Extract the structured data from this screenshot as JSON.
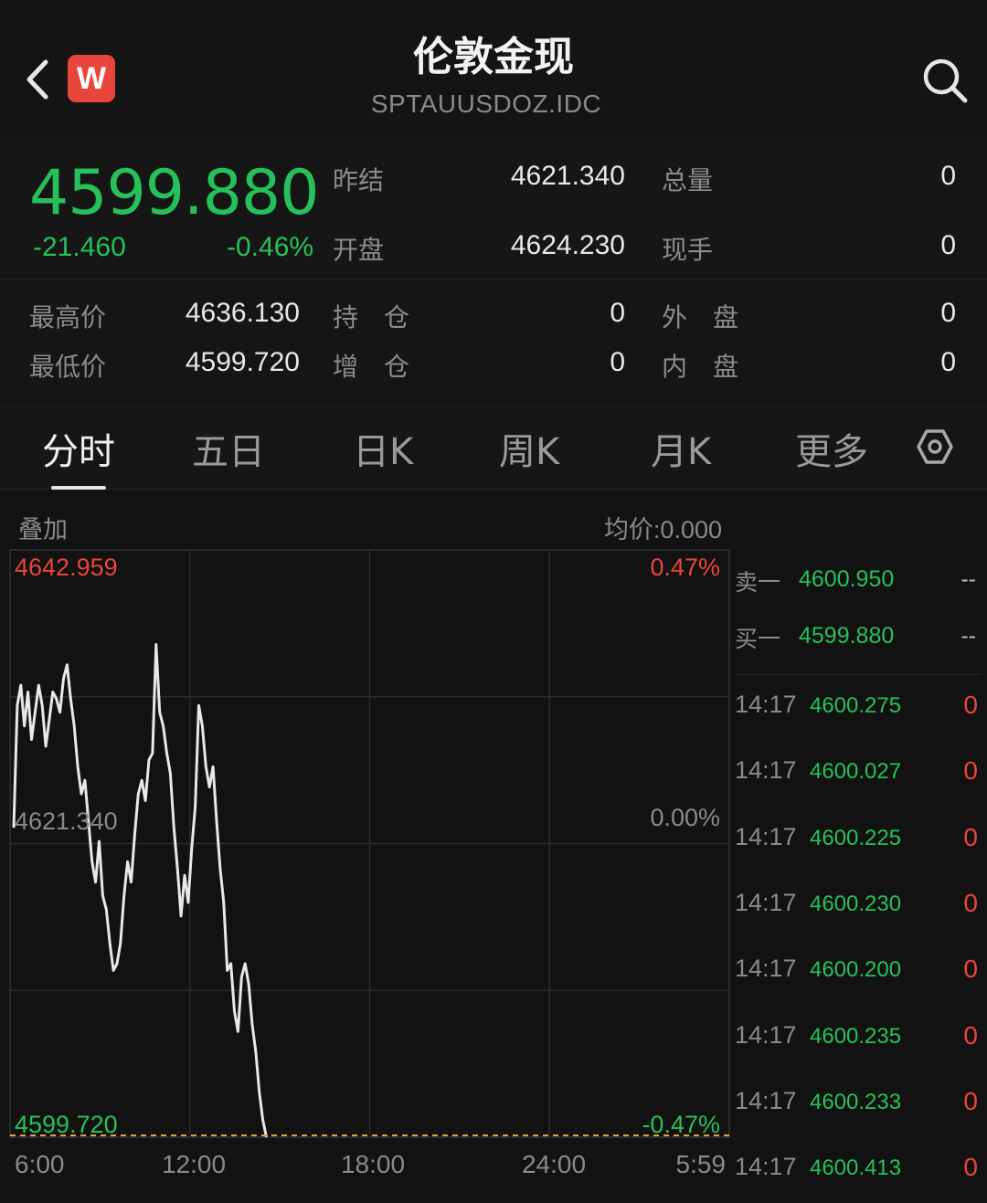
{
  "header": {
    "title": "伦敦金现",
    "code": "SPTAUUSDOZ.IDC",
    "brand_letter": "W"
  },
  "quote": {
    "price": "4599.880",
    "change": "-21.460",
    "change_pct": "-0.46%",
    "prev_settle_label": "昨结",
    "prev_settle": "4621.340",
    "open_label": "开盘",
    "open": "4624.230",
    "total_vol_label": "总量",
    "total_vol": "0",
    "current_hand_label": "现手",
    "current_hand": "0"
  },
  "stats": {
    "high_label": "最高价",
    "high": "4636.130",
    "low_label": "最低价",
    "low": "4599.720",
    "position_label": "持　仓",
    "position": "0",
    "add_position_label": "增　仓",
    "add_position": "0",
    "outer_label": "外　盘",
    "outer": "0",
    "inner_label": "内　盘",
    "inner": "0"
  },
  "tabs": [
    "分时",
    "五日",
    "日K",
    "周K",
    "月K",
    "更多"
  ],
  "chart_header": {
    "overlay_label": "叠加",
    "avg_price": "均价:0.000"
  },
  "chart_data": {
    "type": "line",
    "y_top_label": "4642.959",
    "y_mid_label": "4621.340",
    "y_bottom_label": "4599.720",
    "pct_top": "0.47%",
    "pct_mid": "0.00%",
    "pct_bottom": "-0.47%",
    "x_tick_labels": [
      "6:00",
      "12:00",
      "18:00",
      "24:00",
      "5:59"
    ],
    "ylim": [
      4599.72,
      4642.959
    ],
    "x_fraction_range": [
      0,
      1
    ],
    "series": [
      {
        "x": [
          0.0,
          0.005,
          0.01,
          0.015,
          0.02,
          0.025,
          0.03,
          0.035,
          0.04,
          0.045,
          0.05,
          0.055,
          0.06,
          0.065,
          0.07,
          0.075,
          0.08,
          0.085,
          0.09,
          0.095,
          0.1,
          0.105,
          0.11,
          0.115,
          0.12,
          0.125,
          0.13,
          0.135,
          0.14,
          0.145,
          0.15,
          0.155,
          0.16,
          0.165,
          0.17,
          0.175,
          0.18,
          0.185,
          0.19,
          0.195,
          0.2,
          0.205,
          0.21,
          0.215,
          0.22,
          0.225,
          0.23,
          0.235,
          0.24,
          0.245,
          0.25,
          0.255,
          0.26,
          0.265,
          0.27,
          0.275,
          0.28,
          0.285,
          0.29,
          0.295,
          0.3,
          0.305,
          0.31,
          0.315,
          0.32,
          0.325,
          0.33,
          0.335,
          0.34,
          0.345,
          0.35,
          0.355
        ],
        "y": [
          4622.5,
          4631.5,
          4633.0,
          4630.0,
          4632.5,
          4629.0,
          4631.0,
          4633.0,
          4631.5,
          4628.5,
          4630.5,
          4632.5,
          4632.0,
          4631.0,
          4633.5,
          4634.5,
          4632.0,
          4630.0,
          4627.0,
          4625.0,
          4626.0,
          4623.0,
          4620.0,
          4618.5,
          4621.5,
          4617.5,
          4616.5,
          4614.0,
          4612.0,
          4612.5,
          4614.0,
          4617.5,
          4620.0,
          4618.5,
          4622.0,
          4625.0,
          4626.0,
          4624.5,
          4627.5,
          4628.0,
          4636.0,
          4631.0,
          4630.0,
          4628.0,
          4626.5,
          4622.5,
          4619.5,
          4616.0,
          4619.0,
          4617.0,
          4621.0,
          4624.0,
          4631.5,
          4630.0,
          4627.0,
          4625.5,
          4627.0,
          4623.0,
          4619.5,
          4617.0,
          4612.0,
          4612.5,
          4609.0,
          4607.5,
          4611.5,
          4612.5,
          4611.0,
          4608.0,
          4606.0,
          4603.0,
          4601.0,
          4599.72
        ]
      }
    ]
  },
  "order_book": {
    "sell1_label": "卖一",
    "sell1_price": "4600.950",
    "sell1_vol": "--",
    "buy1_label": "买一",
    "buy1_price": "4599.880",
    "buy1_vol": "--"
  },
  "trades": [
    {
      "time": "14:17",
      "price": "4600.275",
      "vol": "0"
    },
    {
      "time": "14:17",
      "price": "4600.027",
      "vol": "0"
    },
    {
      "time": "14:17",
      "price": "4600.225",
      "vol": "0"
    },
    {
      "time": "14:17",
      "price": "4600.230",
      "vol": "0"
    },
    {
      "time": "14:17",
      "price": "4600.200",
      "vol": "0"
    },
    {
      "time": "14:17",
      "price": "4600.235",
      "vol": "0"
    },
    {
      "time": "14:17",
      "price": "4600.233",
      "vol": "0"
    },
    {
      "time": "14:17",
      "price": "4600.413",
      "vol": "0"
    }
  ],
  "colors": {
    "down": "#26c15a",
    "up": "#e8453c",
    "brand": "#e8453c",
    "line": "#e8e8e8",
    "bottom_dash": "#e8a23c"
  }
}
